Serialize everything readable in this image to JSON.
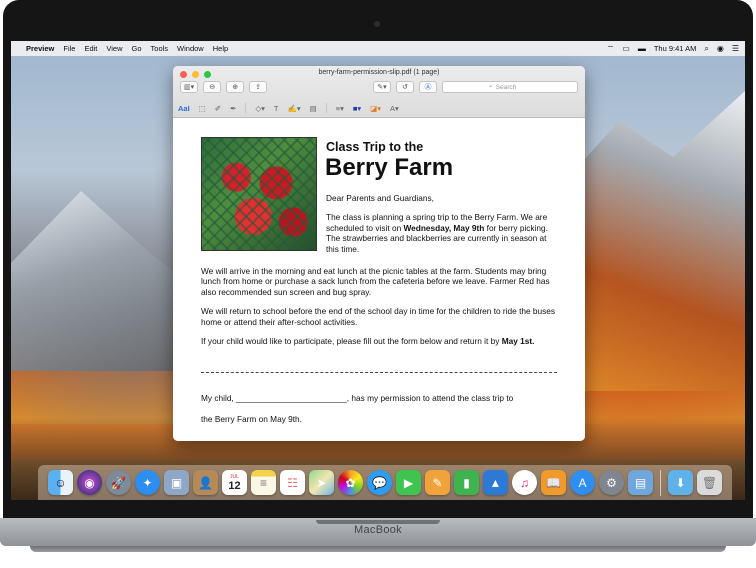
{
  "menubar": {
    "apple": "",
    "app_name": "Preview",
    "menus": [
      "File",
      "Edit",
      "View",
      "Go",
      "Tools",
      "Window",
      "Help"
    ],
    "clock": "Thu 9:41 AM",
    "status_icons": [
      "wifi-icon",
      "airplay-icon",
      "battery-icon",
      "spotlight-icon",
      "siri-icon",
      "notification-center-icon"
    ]
  },
  "window": {
    "title": "berry-farm-permission-slip.pdf (1 page)",
    "search_placeholder": "Search",
    "toolbar_icons": [
      "sidebar-icon",
      "zoom-out-icon",
      "zoom-in-icon",
      "share-icon",
      "pen-icon",
      "rotate-icon",
      "markup-icon"
    ],
    "markup_icons": [
      "text-selection-icon",
      "rect-selection-icon",
      "sketch-icon",
      "draw-icon",
      "shapes-icon",
      "text-icon",
      "sign-icon",
      "note-icon",
      "line-style-icon",
      "border-color-icon",
      "fill-color-icon",
      "text-style-icon"
    ],
    "markup_text_label": "AaI"
  },
  "document": {
    "heading_small": "Class Trip to the",
    "heading_big": "Berry Farm",
    "greeting": "Dear Parents and Guardians,",
    "intro_pre": "The class is planning a spring trip to the Berry Farm. We are scheduled to visit on ",
    "intro_bold": "Wednesday, May 9th",
    "intro_post": " for berry picking. The strawberries and blackberries are currently in season at this time.",
    "para1": "We will arrive in the morning and eat lunch at the picnic tables at the farm. Students may bring lunch from home or purchase a sack lunch from the cafeteria before we leave. Farmer Red has also recommended sun screen and bug spray.",
    "para2": "We will return to school before the end of the school day in time for the children to ride the buses home or attend their after-school activities.",
    "para3_pre": "If your child would like to participate, please fill out the form below and return it by ",
    "para3_bold": "May 1st.",
    "form_line1": "My child, ________________________, has my permission to attend the class trip to",
    "form_line2": "the Berry Farm on May 9th."
  },
  "dock": {
    "calendar_month": "JUL",
    "calendar_day": "12",
    "apps": [
      "finder-icon",
      "siri-icon",
      "launchpad-icon",
      "safari-icon",
      "photos-browser-icon",
      "contacts-icon",
      "calendar-icon",
      "notes-icon",
      "reminders-icon",
      "maps-icon",
      "photos-icon",
      "messages-icon",
      "facetime-icon",
      "pages-icon",
      "numbers-icon",
      "keynote-icon",
      "itunes-icon",
      "ibooks-icon",
      "app-store-icon",
      "system-preferences-icon",
      "preview-icon",
      "downloads-folder-icon",
      "trash-icon"
    ]
  },
  "laptop": {
    "brand": "MacBook"
  }
}
